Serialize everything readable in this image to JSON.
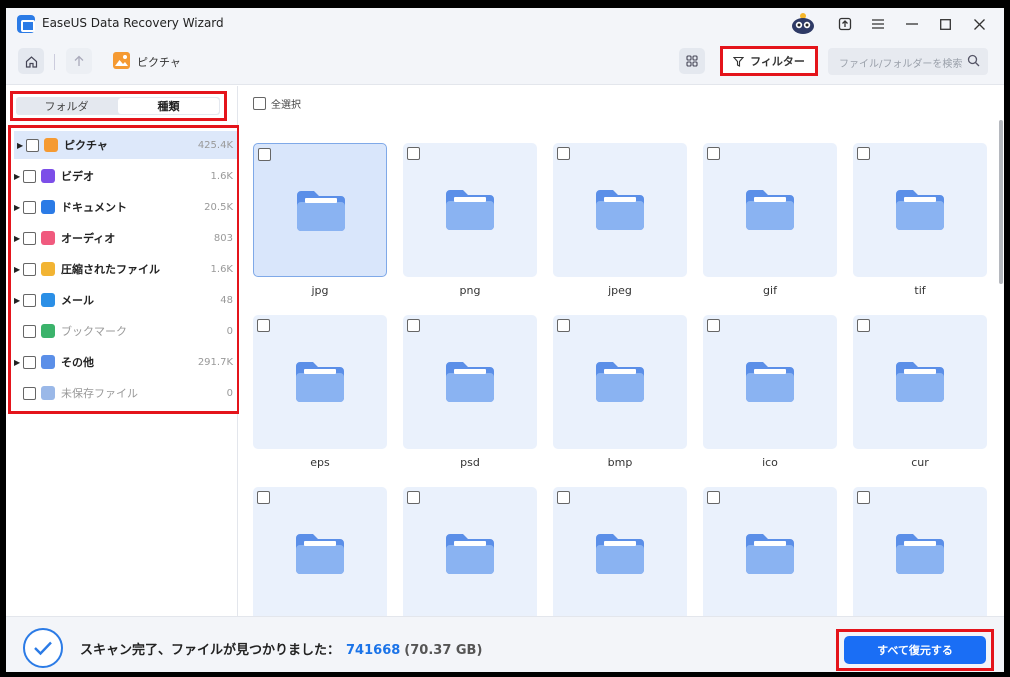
{
  "window": {
    "title": "EaseUS Data Recovery Wizard"
  },
  "toolbar": {
    "breadcrumb": "ピクチャ",
    "filter_label": "フィルター",
    "search_placeholder": "ファイル/フォルダーを検索"
  },
  "sidebar": {
    "tabs": [
      "フォルダ",
      "種類"
    ],
    "active_tab": "種類",
    "items": [
      {
        "label": "ピクチャ",
        "count": "425.4K",
        "icon": "picture-icon",
        "color": "#f59a32",
        "expandable": true
      },
      {
        "label": "ビデオ",
        "count": "1.6K",
        "icon": "video-icon",
        "color": "#7c4ee8",
        "expandable": true
      },
      {
        "label": "ドキュメント",
        "count": "20.5K",
        "icon": "document-icon",
        "color": "#2b7be6",
        "expandable": true
      },
      {
        "label": "オーディオ",
        "count": "803",
        "icon": "audio-icon",
        "color": "#f05a7e",
        "expandable": true
      },
      {
        "label": "圧縮されたファイル",
        "count": "1.6K",
        "icon": "archive-icon",
        "color": "#f2b433",
        "expandable": true
      },
      {
        "label": "メール",
        "count": "48",
        "icon": "mail-icon",
        "color": "#2b8fe6",
        "expandable": true
      },
      {
        "label": "ブックマーク",
        "count": "0",
        "icon": "bookmark-icon",
        "color": "#3bb36b",
        "expandable": false
      },
      {
        "label": "その他",
        "count": "291.7K",
        "icon": "other-icon",
        "color": "#5b8fe8",
        "expandable": true
      },
      {
        "label": "未保存ファイル",
        "count": "0",
        "icon": "unsaved-file-icon",
        "color": "#9ab8e8",
        "expandable": false
      }
    ]
  },
  "main": {
    "select_all": "全選択",
    "folders": [
      "jpg",
      "png",
      "jpeg",
      "gif",
      "tif",
      "eps",
      "psd",
      "bmp",
      "ico",
      "cur",
      "",
      "",
      "",
      "",
      ""
    ]
  },
  "footer": {
    "status": "スキャン完了、ファイルが見つかりました：",
    "count": "741668",
    "size": "(70.37 GB)",
    "recover_label": "すべて復元する"
  },
  "colors": {
    "accent": "#1a6ef5",
    "highlight": "#e4141b",
    "card": "#eaf1fc"
  }
}
